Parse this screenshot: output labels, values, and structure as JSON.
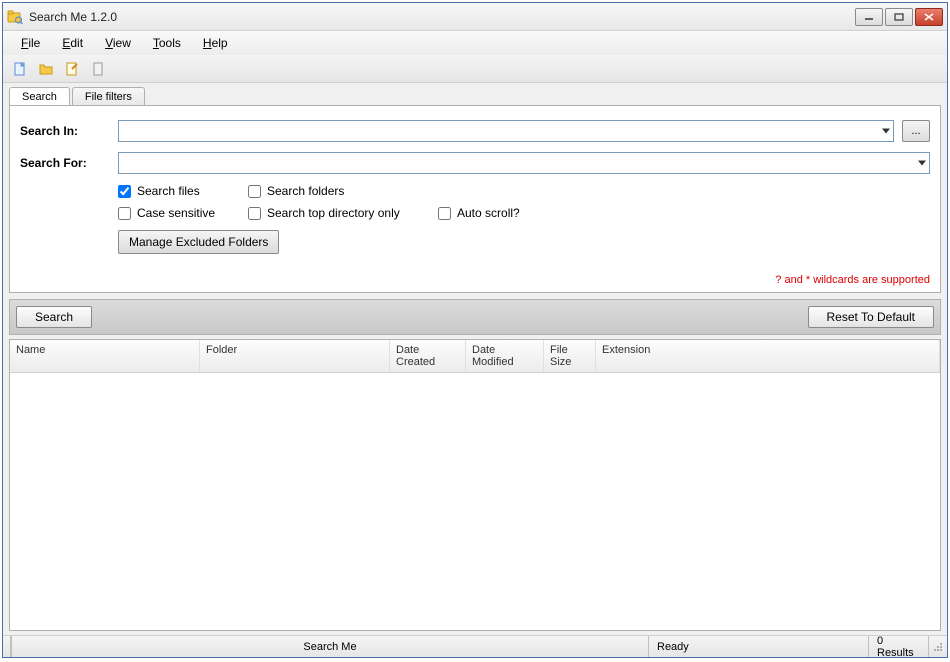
{
  "title": "Search Me 1.2.0",
  "menu": {
    "file": "File",
    "edit": "Edit",
    "view": "View",
    "tools": "Tools",
    "help": "Help"
  },
  "tabs": {
    "search": "Search",
    "filters": "File filters"
  },
  "form": {
    "search_in_label": "Search In:",
    "search_for_label": "Search For:",
    "search_in_value": "",
    "search_for_value": "",
    "browse_label": "..."
  },
  "checks": {
    "search_files": "Search files",
    "search_folders": "Search folders",
    "case_sensitive": "Case sensitive",
    "top_only": "Search top directory only",
    "auto_scroll": "Auto scroll?"
  },
  "checks_state": {
    "search_files": true,
    "search_folders": false,
    "case_sensitive": false,
    "top_only": false,
    "auto_scroll": false
  },
  "manage_btn": "Manage Excluded Folders",
  "hint": "? and * wildcards are supported",
  "actions": {
    "search": "Search",
    "reset": "Reset To Default"
  },
  "columns": {
    "name": "Name",
    "folder": "Folder",
    "date_created": "Date Created",
    "date_modified": "Date Modified",
    "file_size": "File Size",
    "extension": "Extension"
  },
  "status": {
    "app": "Search Me",
    "state": "Ready",
    "results": "0 Results"
  }
}
